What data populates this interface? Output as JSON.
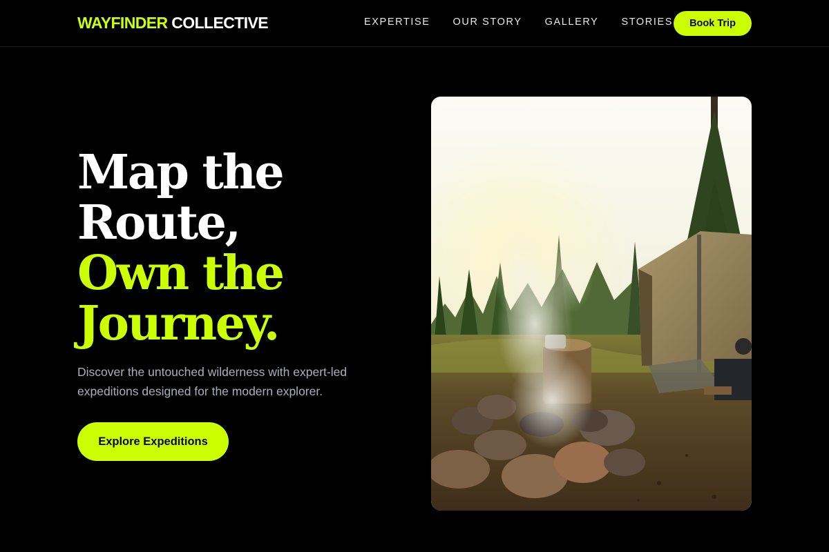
{
  "nav": {
    "brand_accent": "WAYFINDER",
    "brand_rest": "COLLECTIVE",
    "links": [
      "EXPERTISE",
      "OUR STORY",
      "GALLERY",
      "STORIES"
    ],
    "cta_label": "Book Trip"
  },
  "hero": {
    "headline_white_1": "Map the",
    "headline_white_2": "Route,",
    "headline_accent_1": "Own the",
    "headline_accent_2": "Journey.",
    "subtext": "Discover the untouched wilderness with expert-led expeditions designed for the modern explorer.",
    "cta_label": "Explore Expeditions"
  },
  "image": {
    "subject": "campfire with smoke beside a canvas tent in a pine forest"
  },
  "colors": {
    "accent": "#CCFF00",
    "background": "#000000",
    "muted_text": "#a9afba"
  }
}
